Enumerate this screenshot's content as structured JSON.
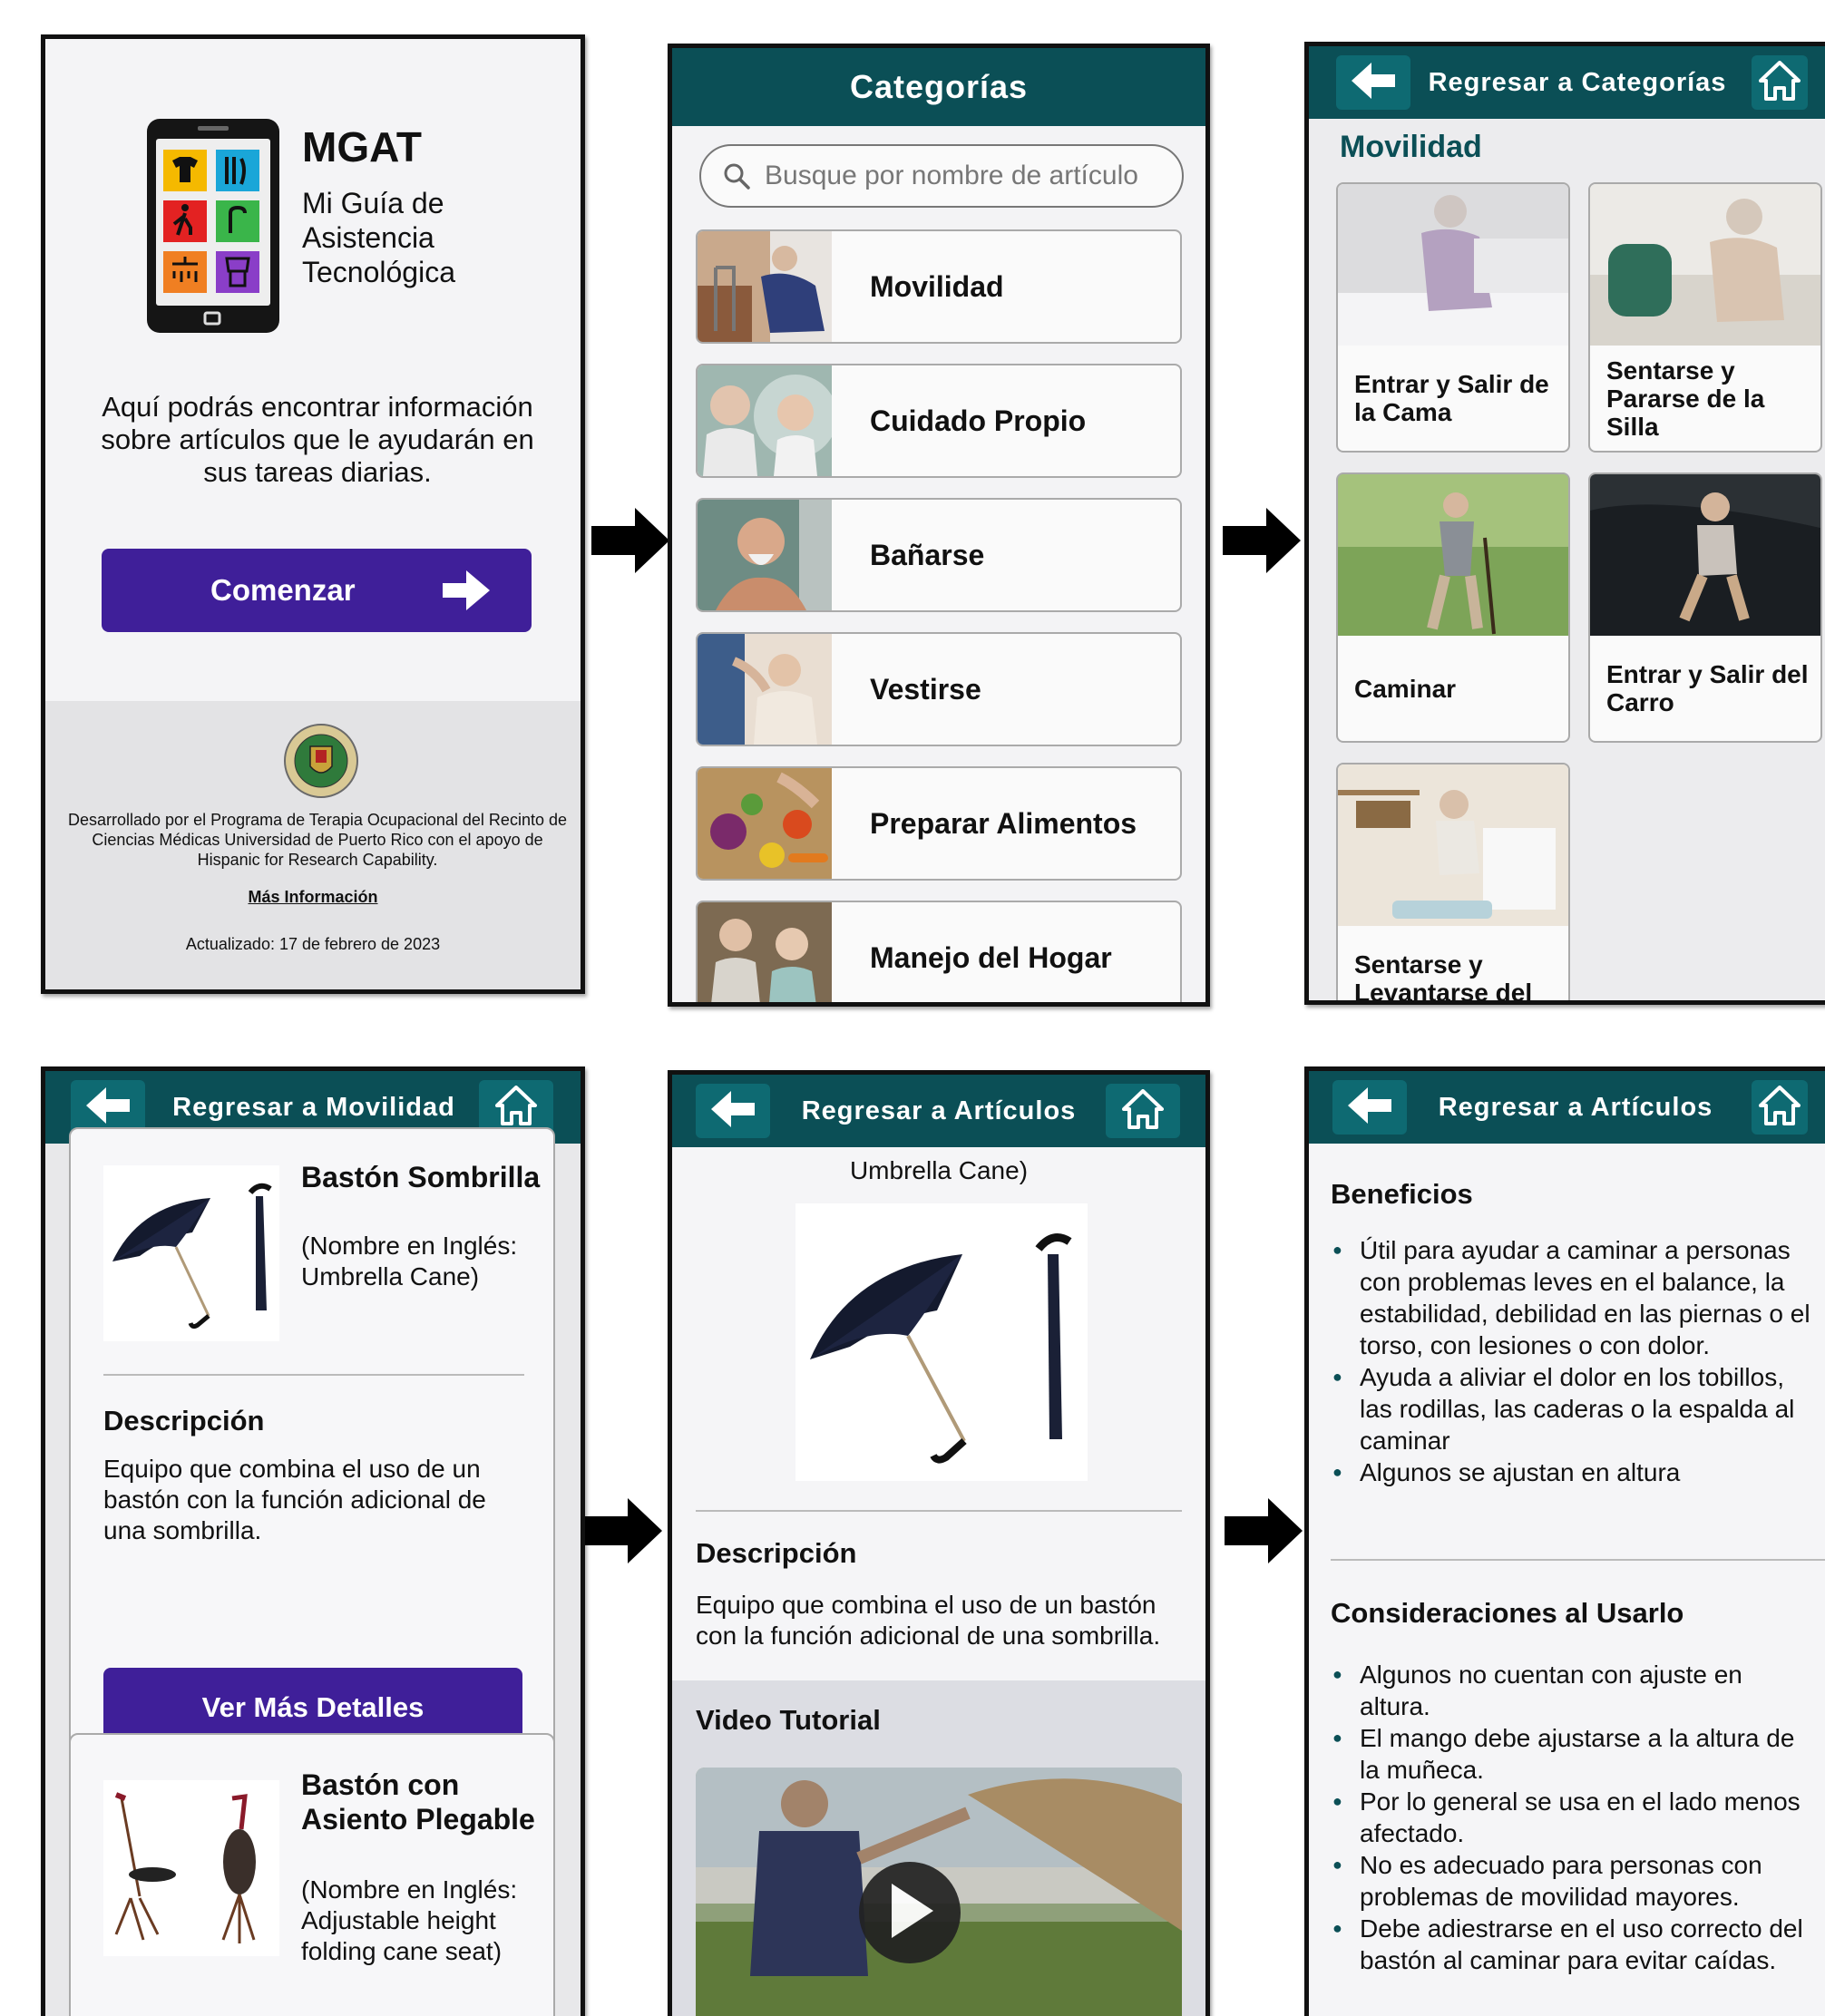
{
  "screen_home": {
    "app_name": "MGAT",
    "app_subtitle": "Mi Guía de Asistencia Tecnológica",
    "intro": "Aquí podrás encontrar información sobre artículos que le ayudarán en sus tareas diarias.",
    "start_label": "Comenzar",
    "credit": "Desarrollado por el Programa de Terapia Ocupacional del Recinto de Ciencias Médicas Universidad de Puerto Rico con el apoyo de Hispanic for Research Capability.",
    "more_info": "Más Información",
    "updated": "Actualizado: 17 de febrero de 2023"
  },
  "screen_categories": {
    "title": "Categorías",
    "search_placeholder": "Busque por nombre de artículo",
    "items": [
      {
        "label": "Movilidad"
      },
      {
        "label": "Cuidado Propio"
      },
      {
        "label": "Bañarse"
      },
      {
        "label": "Vestirse"
      },
      {
        "label": "Preparar Alimentos"
      },
      {
        "label": "Manejo del Hogar"
      }
    ]
  },
  "screen_mobility": {
    "back_label": "Regresar a Categorías",
    "section": "Movilidad",
    "cards": [
      {
        "label": "Entrar y Salir de la Cama"
      },
      {
        "label": "Sentarse y Pararse de la Silla"
      },
      {
        "label": "Caminar"
      },
      {
        "label": "Entrar y Salir del Carro"
      },
      {
        "label": "Sentarse y Levantarse del"
      }
    ]
  },
  "screen_articles": {
    "back_label": "Regresar a Movilidad",
    "products": [
      {
        "name": "Bastón Sombrilla",
        "english": "(Nombre en Inglés: Umbrella Cane)"
      },
      {
        "name": "Bastón con Asiento Plegable",
        "english": "(Nombre en Inglés: Adjustable height folding cane seat)"
      }
    ],
    "desc_heading": "Descripción",
    "desc_text": "Equipo que combina el uso de un bastón con la función adicional de una sombrilla.",
    "details_button": "Ver Más Detalles"
  },
  "screen_detail": {
    "back_label": "Regresar a Artículos",
    "english_caption": "Umbrella Cane)",
    "desc_heading": "Descripción",
    "desc_text": "Equipo que combina el uso de un bastón con la función adicional de una sombrilla.",
    "video_heading": "Video Tutorial"
  },
  "screen_benefits": {
    "back_label": "Regresar a Artículos",
    "benefits_heading": "Beneficios",
    "benefits": [
      "Útil para ayudar a caminar a personas con problemas leves en el balance, la estabilidad, debilidad en las piernas o el torso, con lesiones o con dolor.",
      "Ayuda a aliviar el dolor en los tobillos, las rodillas, las caderas o la espalda al caminar",
      "Algunos se ajustan en altura"
    ],
    "considerations_heading": "Consideraciones al Usarlo",
    "considerations": [
      "Algunos no cuentan con ajuste en altura.",
      "El mango debe ajustarse a la altura de la muñeca.",
      "Por lo general se usa en el lado menos afectado.",
      "No es adecuado para personas con problemas de movilidad mayores.",
      "Debe adiestrarse en el uso correcto del bastón al caminar para evitar caídas."
    ]
  },
  "icons": {
    "back": "arrow-left-icon",
    "home": "home-icon",
    "search": "search-icon",
    "play": "play-icon",
    "flow": "flow-arrow-icon"
  },
  "colors": {
    "header_teal": "#0b4f56",
    "button_purple": "#3f1f99",
    "section_teal": "#0b4f56"
  }
}
